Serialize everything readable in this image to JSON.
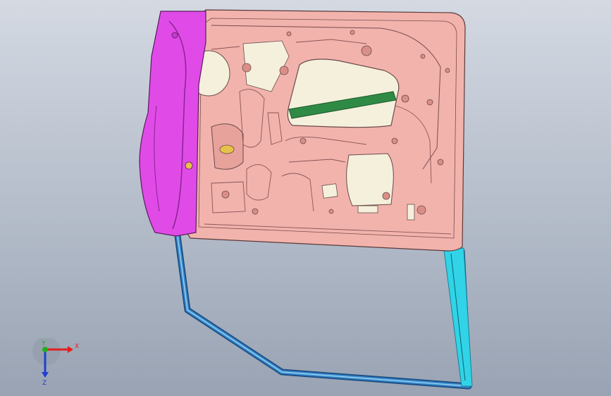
{
  "viewport": {
    "background_top": "#d4d9e2",
    "background_bottom": "#99a3b3"
  },
  "model": {
    "inner_panel_color": "#f2b3ad",
    "hinge_side_color": "#e04be8",
    "window_frame_color": "#2e7fbf",
    "window_frame_accent_color": "#30d4e6",
    "belt_strip_color": "#2f8a45",
    "cutout_color": "#f4f0dc"
  },
  "triad": {
    "x_label": "X",
    "y_label": "Y",
    "z_label": "Z",
    "x_color": "#e02020",
    "y_color": "#20b020",
    "z_color": "#2040d0"
  }
}
